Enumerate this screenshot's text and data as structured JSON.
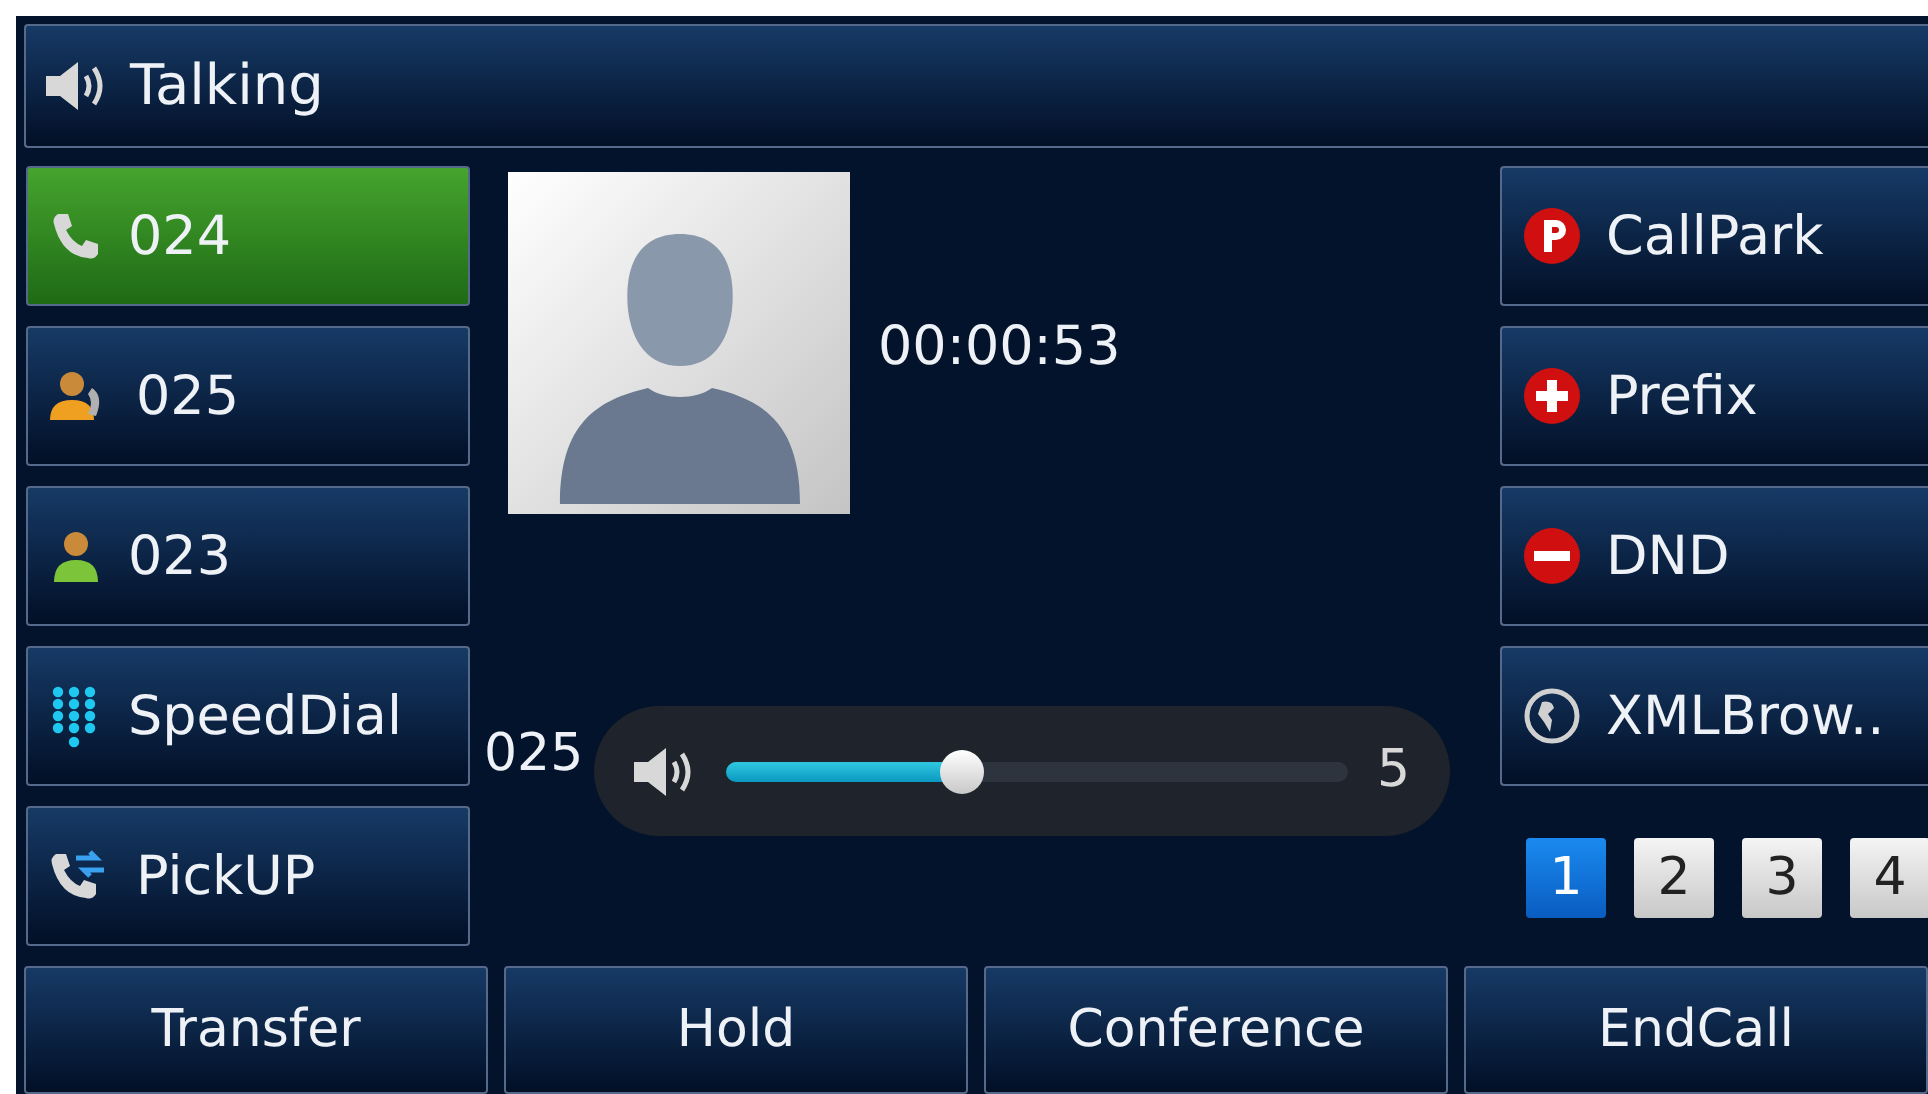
{
  "title_bar": {
    "text": "Talking"
  },
  "line_keys": [
    {
      "label": "024",
      "kind": "phone",
      "selected": true
    },
    {
      "label": "025",
      "kind": "contact-calling",
      "selected": false
    },
    {
      "label": "023",
      "kind": "contact",
      "selected": false
    },
    {
      "label": "SpeedDial",
      "kind": "keypad",
      "selected": false
    },
    {
      "label": "PickUP",
      "kind": "pickup",
      "selected": false
    }
  ],
  "call": {
    "duration": "00:00:53",
    "number": "025"
  },
  "volume": {
    "level": 0.38,
    "reading": "5"
  },
  "function_keys": [
    {
      "label": "CallPark",
      "kind": "park"
    },
    {
      "label": "Prefix",
      "kind": "plus"
    },
    {
      "label": "DND",
      "kind": "minus"
    },
    {
      "label": "XMLBrow..",
      "kind": "globe"
    }
  ],
  "pages": [
    {
      "label": "1",
      "selected": true
    },
    {
      "label": "2",
      "selected": false
    },
    {
      "label": "3",
      "selected": false
    },
    {
      "label": "4",
      "selected": false
    }
  ],
  "softkeys": [
    "Transfer",
    "Hold",
    "Conference",
    "EndCall"
  ]
}
